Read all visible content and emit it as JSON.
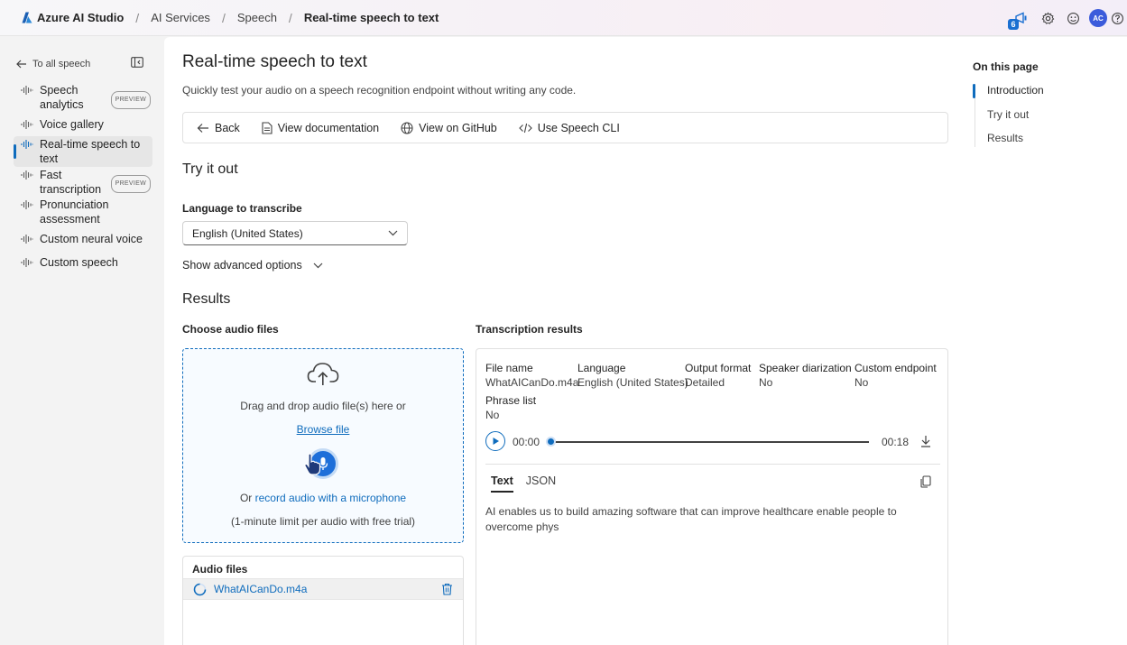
{
  "breadcrumb": {
    "brand": "Azure AI Studio",
    "items": [
      "AI Services",
      "Speech"
    ],
    "current": "Real-time speech to text",
    "separator": "/"
  },
  "top_actions": {
    "notification_count": "6",
    "avatar_initials": "AC",
    "icons": [
      "megaphone-icon",
      "settings-icon",
      "feedback-icon",
      "avatar",
      "help-icon"
    ]
  },
  "sidebar": {
    "back_label": "To all speech",
    "items": [
      {
        "label": "Speech analytics",
        "badge": "PREVIEW"
      },
      {
        "label": "Voice gallery",
        "badge": ""
      },
      {
        "label": "Real-time speech to text",
        "badge": ""
      },
      {
        "label": "Fast transcription",
        "badge": "PREVIEW"
      },
      {
        "label": "Pronunciation assessment",
        "badge": ""
      },
      {
        "label": "Custom neural voice",
        "badge": ""
      },
      {
        "label": "Custom speech",
        "badge": ""
      }
    ],
    "active_index": 2
  },
  "main": {
    "title": "Real-time speech to text",
    "subtitle": "Quickly test your audio on a speech recognition endpoint without writing any code.",
    "toolbar": {
      "back": "Back",
      "docs": "View documentation",
      "github": "View on GitHub",
      "cli": "Use Speech CLI"
    },
    "try_it_out": "Try it out",
    "language_label": "Language to transcribe",
    "language_value": "English (United States)",
    "advanced_options": "Show advanced options",
    "results_heading": "Results",
    "choose_audio": "Choose audio files",
    "transcription_heading": "Transcription results"
  },
  "dropzone": {
    "drag_text": "Drag and drop audio file(s) here or",
    "browse": "Browse file",
    "or_text": "Or ",
    "record_link": "record audio with a microphone",
    "limit": "(1-minute limit per audio with free trial)"
  },
  "audio_files": {
    "heading": "Audio files",
    "files": [
      {
        "name": "WhatAICanDo.m4a",
        "status": "processing"
      }
    ]
  },
  "transcription": {
    "meta": [
      {
        "key": "File name",
        "value": "WhatAICanDo.m4a"
      },
      {
        "key": "Language",
        "value": "English (United States)"
      },
      {
        "key": "Output format",
        "value": "Detailed"
      },
      {
        "key": "Speaker diarization",
        "value": "No"
      },
      {
        "key": "Custom endpoint",
        "value": "No"
      }
    ],
    "phrase_list": {
      "key": "Phrase list",
      "value": "No"
    },
    "player": {
      "current": "00:00",
      "duration": "00:18",
      "progress": 0
    },
    "tabs": [
      "Text",
      "JSON"
    ],
    "active_tab": 0,
    "text": "AI enables us to build amazing software that can improve healthcare enable people to overcome phys"
  },
  "on_this_page": {
    "heading": "On this page",
    "items": [
      "Introduction",
      "Try it out",
      "Results"
    ],
    "active_index": 0
  },
  "colors": {
    "accent": "#0f6cbd",
    "badge": "#1a6fd1",
    "avatar": "#3b5bdb"
  }
}
